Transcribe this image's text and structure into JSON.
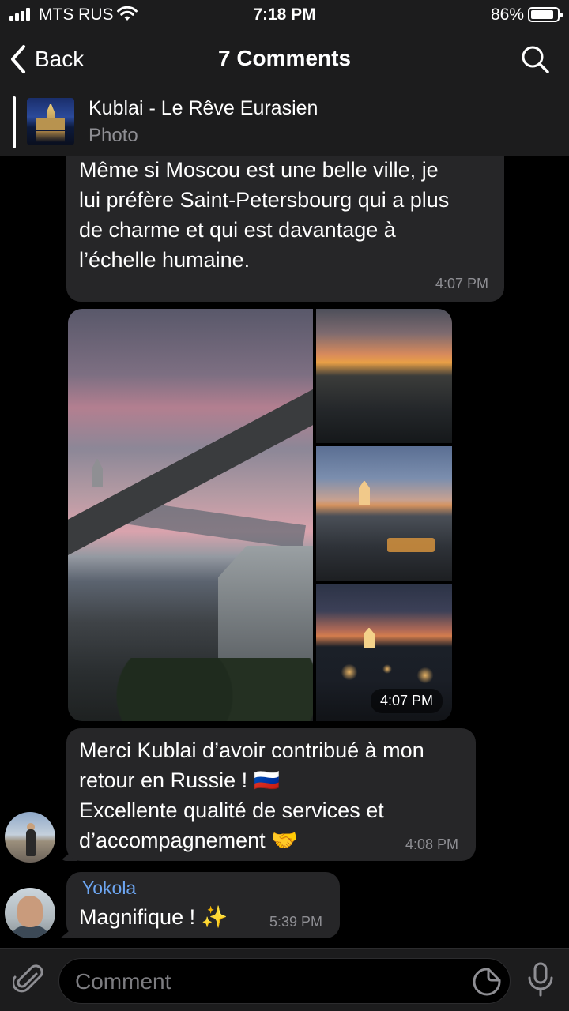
{
  "status_bar": {
    "carrier": "MTS RUS",
    "time": "7:18 PM",
    "battery": "86%",
    "battery_level": 0.86
  },
  "nav": {
    "back_label": "Back",
    "title": "7 Comments"
  },
  "pinned": {
    "title": "Kublai - Le Rêve Eurasien",
    "subtitle": "Photo"
  },
  "messages": [
    {
      "text": "Moscou.\nMême si Moscou est une belle ville, je\nlui préfère Saint-Petersbourg qui a plus\nde charme et qui est davantage à\nl’échelle humaine.",
      "time": "4:07 PM"
    },
    {
      "type": "album",
      "time": "4:07 PM"
    },
    {
      "text": "Merci Kublai d’avoir contribué à mon\nretour en Russie ! 🇷🇺\nExcellente qualité de services et\nd’accompagnement 🤝",
      "time": "4:08 PM"
    },
    {
      "sender": "Yokola",
      "text": "Magnifique ! ✨",
      "time": "5:39 PM"
    }
  ],
  "input": {
    "placeholder": "Comment"
  },
  "colors": {
    "background": "#000000",
    "bar": "#1c1c1d",
    "bubble": "#262628",
    "sender_name": "#6da6f2",
    "meta": "#8e8e93"
  }
}
